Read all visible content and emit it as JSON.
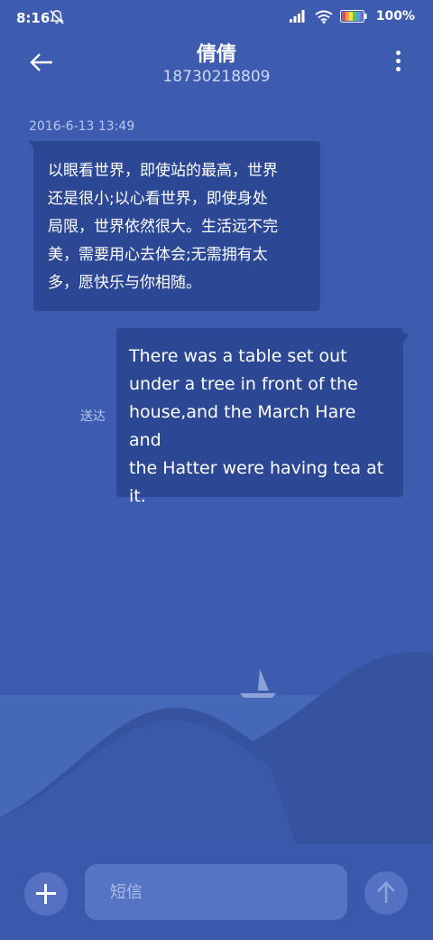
{
  "status_bar": {
    "time": "8:16",
    "battery_percent": "100%",
    "icons": [
      "mute-bell-icon",
      "signal-icon",
      "wifi-icon",
      "battery-icon"
    ]
  },
  "header": {
    "contact_name": "倩倩",
    "contact_number": "18730218809",
    "back_icon": "back-arrow-icon",
    "more_icon": "more-vertical-icon"
  },
  "conversation": {
    "timestamp": "2016-6-13 13:49",
    "messages": [
      {
        "direction": "incoming",
        "lines": [
          "以眼看世界，即使站的最高，世界",
          "还是很小;以心看世界，即使身处",
          "局限，世界依然很大。生活远不完",
          "美，需要用心去体会;无需拥有太",
          "多，愿快乐与你相随。"
        ]
      },
      {
        "direction": "outgoing",
        "lines": [
          "There was a table set out",
          "under a tree in front of the",
          "house,and the March Hare and",
          "the Hatter were having tea at",
          "it."
        ],
        "status": "送达"
      }
    ]
  },
  "input_bar": {
    "add_icon": "plus-icon",
    "placeholder": "短信",
    "value": "",
    "send_icon": "send-arrow-icon"
  },
  "colors": {
    "background": "#3d5cb0",
    "bubble": "#2c4894",
    "input": "#5674c4"
  }
}
